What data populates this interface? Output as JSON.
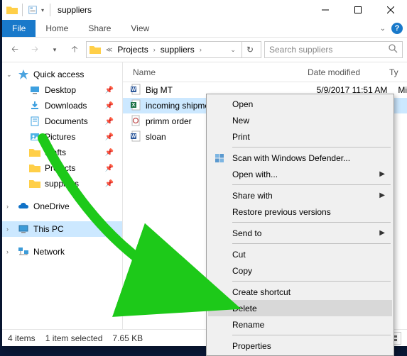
{
  "window": {
    "title": "suppliers"
  },
  "ribbon": {
    "file": "File",
    "tabs": [
      "Home",
      "Share",
      "View"
    ]
  },
  "address": {
    "crumbs": [
      "Projects",
      "suppliers"
    ]
  },
  "search": {
    "placeholder": "Search suppliers"
  },
  "sidebar": {
    "quick_access": "Quick access",
    "items": [
      {
        "label": "Desktop",
        "pinned": true,
        "icon": "desktop"
      },
      {
        "label": "Downloads",
        "pinned": true,
        "icon": "downloads"
      },
      {
        "label": "Documents",
        "pinned": true,
        "icon": "documents"
      },
      {
        "label": "Pictures",
        "pinned": true,
        "icon": "pictures"
      },
      {
        "label": "drafts",
        "pinned": true,
        "icon": "folder"
      },
      {
        "label": "Projects",
        "pinned": true,
        "icon": "folder"
      },
      {
        "label": "suppliers",
        "pinned": true,
        "icon": "folder"
      }
    ],
    "onedrive": "OneDrive",
    "thispc": "This PC",
    "network": "Network"
  },
  "columns": {
    "name": "Name",
    "date": "Date modified",
    "type": "Ty"
  },
  "files": [
    {
      "name": "Big MT",
      "date": "5/9/2017 11:51 AM",
      "type": "Mi",
      "icon": "word",
      "selected": false
    },
    {
      "name": "incoming shipme",
      "date": "",
      "type": "",
      "icon": "excel",
      "selected": true
    },
    {
      "name": "primm order",
      "date": "",
      "type": "",
      "icon": "pdf",
      "selected": false
    },
    {
      "name": "sloan",
      "date": "",
      "type": "",
      "icon": "word",
      "selected": false
    }
  ],
  "status": {
    "count": "4 items",
    "selection": "1 item selected",
    "size": "7.65 KB"
  },
  "context_menu": {
    "groups": [
      [
        {
          "label": "Open"
        },
        {
          "label": "New"
        },
        {
          "label": "Print"
        }
      ],
      [
        {
          "label": "Scan with Windows Defender...",
          "icon": "defender"
        },
        {
          "label": "Open with...",
          "submenu": true
        }
      ],
      [
        {
          "label": "Share with",
          "submenu": true
        },
        {
          "label": "Restore previous versions"
        }
      ],
      [
        {
          "label": "Send to",
          "submenu": true
        }
      ],
      [
        {
          "label": "Cut"
        },
        {
          "label": "Copy"
        }
      ],
      [
        {
          "label": "Create shortcut"
        },
        {
          "label": "Delete",
          "highlight": true
        },
        {
          "label": "Rename"
        }
      ],
      [
        {
          "label": "Properties"
        }
      ]
    ]
  }
}
